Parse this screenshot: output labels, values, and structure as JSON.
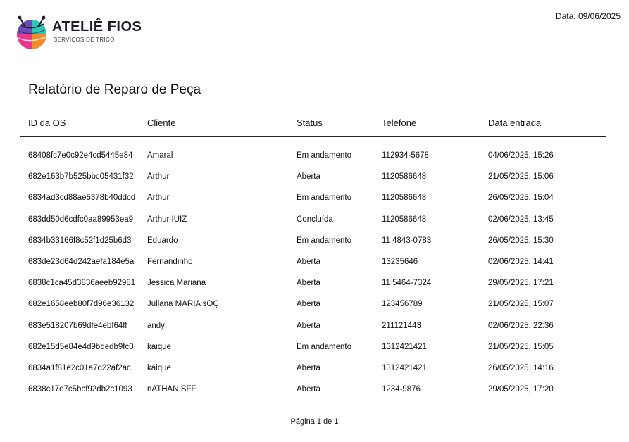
{
  "header": {
    "brand_name": "ATELIÊ FIOS",
    "brand_tagline": "SERVIÇOS DE TRICO",
    "date_label": "Data: 09/06/2025"
  },
  "report": {
    "title": "Relatório de Reparo de Peça",
    "columns": [
      "ID da OS",
      "Cliente",
      "Status",
      "Telefone",
      "Data entrada"
    ],
    "rows": [
      [
        "68408fc7e0c92e4cd5445e84",
        "Amaral",
        "Em andamento",
        "112934-5678",
        "04/06/2025, 15:26"
      ],
      [
        "682e163b7b525bbc05431f32",
        "Arthur",
        "Aberta",
        "1120586648",
        "21/05/2025, 15:06"
      ],
      [
        "6834ad3cd88ae5378b40ddcd",
        "Arthur",
        "Em andamento",
        "1120586648",
        "26/05/2025, 15:04"
      ],
      [
        "683dd50d6cdfc0aa89953ea9",
        "Arthur IUIZ",
        "Concluída",
        "1120586648",
        "02/06/2025, 13:45"
      ],
      [
        "6834b33166f8c52f1d25b6d3",
        "Eduardo",
        "Em andamento",
        "11 4843-0783",
        "26/05/2025, 15:30"
      ],
      [
        "683de23d64d242aefa184e5a",
        "Fernandinho",
        "Aberta",
        "13235646",
        "02/06/2025, 14:41"
      ],
      [
        "6838c1ca45d3836aeeb92981",
        "Jessica Mariana",
        "Aberta",
        "11 5464-7324",
        "29/05/2025, 17:21"
      ],
      [
        "682e1658eeb80f7d96e36132",
        "Juliana MARIA sOÇ",
        "Aberta",
        "123456789",
        "21/05/2025, 15:07"
      ],
      [
        "683e518207b69dfe4ebf64ff",
        "andy",
        "Aberta",
        "211121443",
        "02/06/2025, 22:36"
      ],
      [
        "682e15d5e84e4d9bdedb9fc0",
        "kaique",
        "Em andamento",
        "1312421421",
        "21/05/2025, 15:05"
      ],
      [
        "6834a1f81e2c01a7d22af2ac",
        "kaique",
        "Aberta",
        "1312421421",
        "26/05/2025, 14:16"
      ],
      [
        "6838c17e7c5bcf92db2c1093",
        "nATHAN SFF",
        "Aberta",
        "1234-9876",
        "29/05/2025, 17:20"
      ]
    ]
  },
  "footer": {
    "page_label": "Página 1 de 1"
  }
}
